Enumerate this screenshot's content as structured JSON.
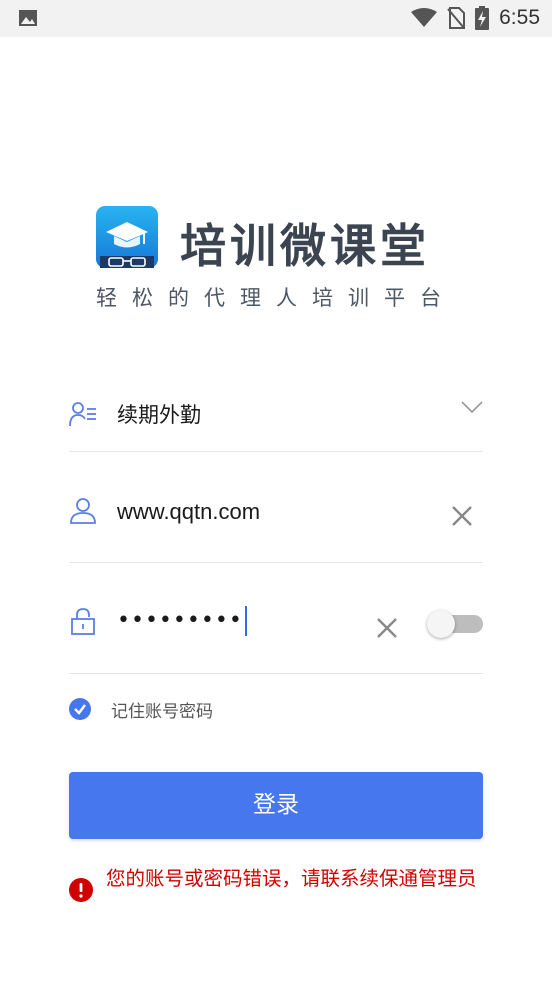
{
  "status_bar": {
    "time": "6:55",
    "icons": [
      "image-icon",
      "wifi-icon",
      "no-sim-icon",
      "battery-charging-icon"
    ]
  },
  "brand": {
    "app_name": "培训微课堂",
    "tagline": "轻松的代理人培训平台",
    "logo_icon": "graduation-cap-logo"
  },
  "form": {
    "role": {
      "value": "续期外勤",
      "icon": "user-list-icon",
      "dropdown_icon": "chevron-down-icon"
    },
    "username": {
      "value": "www.qqtn.com",
      "icon": "user-icon",
      "clear_icon": "close-icon"
    },
    "password": {
      "value": "•••••••••",
      "icon": "lock-icon",
      "clear_icon": "close-icon",
      "show_password": false
    },
    "remember": {
      "label": "记住账号密码",
      "checked": true
    }
  },
  "login_button": {
    "label": "登录"
  },
  "error": {
    "message": "您的账号或密码错误，请联系续保通管理员",
    "icon": "error-icon"
  },
  "colors": {
    "accent": "#4677ee",
    "error": "#d10000",
    "icon_blue": "#5a7fe6",
    "title": "#3b4450"
  }
}
